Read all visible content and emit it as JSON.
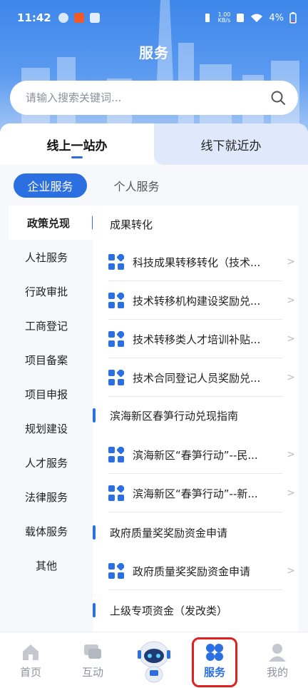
{
  "status_bar": {
    "time": "11:42",
    "speed_value": "1.00",
    "speed_unit": "KB/s",
    "battery": "4%"
  },
  "header": {
    "title": "服务"
  },
  "search": {
    "placeholder": "请输入搜索关键词..."
  },
  "top_tabs": [
    {
      "label": "线上一站办",
      "active": true
    },
    {
      "label": "线下就近办",
      "active": false
    }
  ],
  "sub_tabs": [
    {
      "label": "企业服务",
      "active": true
    },
    {
      "label": "个人服务",
      "active": false
    }
  ],
  "left_nav": [
    "政策兑现",
    "人社服务",
    "行政审批",
    "工商登记",
    "项目备案",
    "项目申报",
    "规划建设",
    "人才服务",
    "法律服务",
    "载体服务",
    "其他"
  ],
  "sections": [
    {
      "title": "成果转化",
      "items": [
        "科技成果转移转化（技术...",
        "技术转移机构建设奖励兑...",
        "技术转移类人才培训补贴...",
        "技术合同登记人员奖励兑..."
      ]
    },
    {
      "title": "滨海新区春笋行动兑现指南",
      "items": [
        "滨海新区“春笋行动”--民...",
        "滨海新区“春笋行动”--新..."
      ]
    },
    {
      "title": "政府质量奖奖励资金申请",
      "items": [
        "政府质量奖奖励资金申请"
      ]
    },
    {
      "title": "上级专项资金（发改类）",
      "items": []
    }
  ],
  "bottom_nav": [
    {
      "label": "首页",
      "icon": "home-icon"
    },
    {
      "label": "互动",
      "icon": "chat-icon"
    },
    {
      "label": "服务",
      "icon": "service-grid-icon",
      "active": true
    },
    {
      "label": "我的",
      "icon": "user-icon"
    }
  ],
  "colors": {
    "accent": "#2b6fe0",
    "highlight": "#e02020"
  }
}
